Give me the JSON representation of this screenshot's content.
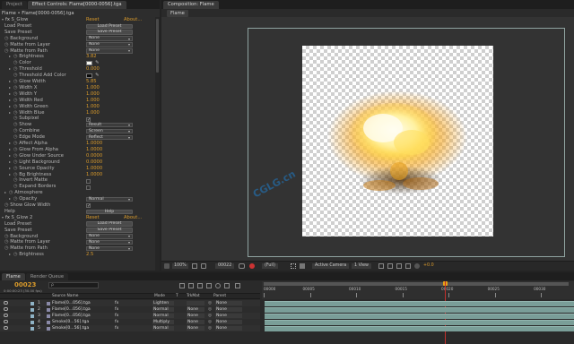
{
  "effect_controls": {
    "tab_project": "Project",
    "tab_title": "Effect Controls: Flame[0000-0056].tga",
    "breadcrumb": "Flame • Flame[0000-0056].tga",
    "effect1": {
      "name": "S_Glow",
      "reset": "Reset",
      "about": "About...",
      "rows": [
        {
          "label": "Load Preset",
          "kind": "button",
          "value": "Load Preset",
          "indent": 1
        },
        {
          "label": "Save Preset",
          "kind": "button",
          "value": "Save Preset",
          "indent": 1
        },
        {
          "label": "Background",
          "kind": "dropdown",
          "value": "None",
          "indent": 1
        },
        {
          "label": "Matte from Layer",
          "kind": "dropdown",
          "value": "None",
          "indent": 1
        },
        {
          "label": "Matte from Path",
          "kind": "dropdown",
          "value": "None",
          "indent": 1
        },
        {
          "label": "Brightness",
          "kind": "value",
          "value": "3.82",
          "indent": 2,
          "tri": true
        },
        {
          "label": "Color",
          "kind": "color",
          "value": "",
          "indent": 3,
          "color": "#f4f4ee"
        },
        {
          "label": "Threshold",
          "kind": "value",
          "value": "0.000",
          "indent": 2,
          "tri": true
        },
        {
          "label": "Threshold Add Color",
          "kind": "color",
          "value": "",
          "indent": 3,
          "color": "#0a0a0a"
        },
        {
          "label": "Glow Width",
          "kind": "value",
          "value": "5.85",
          "indent": 2,
          "tri": true
        },
        {
          "label": "Width X",
          "kind": "value",
          "value": "1.000",
          "indent": 2,
          "tri": true
        },
        {
          "label": "Width Y",
          "kind": "value",
          "value": "1.000",
          "indent": 2,
          "tri": true
        },
        {
          "label": "Width Red",
          "kind": "value",
          "value": "1.000",
          "indent": 2,
          "tri": true
        },
        {
          "label": "Width Green",
          "kind": "value",
          "value": "1.000",
          "indent": 2,
          "tri": true
        },
        {
          "label": "Width Blue",
          "kind": "value",
          "value": "1.000",
          "indent": 2,
          "tri": true
        },
        {
          "label": "Subpixel",
          "kind": "check",
          "value": "✓",
          "indent": 3
        },
        {
          "label": "Show",
          "kind": "dropdown",
          "value": "Result",
          "indent": 3
        },
        {
          "label": "Combine",
          "kind": "dropdown",
          "value": "Screen",
          "indent": 3
        },
        {
          "label": "Edge Mode",
          "kind": "dropdown",
          "value": "Reflect",
          "indent": 3
        },
        {
          "label": "Affect Alpha",
          "kind": "value",
          "value": "1.0000",
          "indent": 2,
          "tri": true
        },
        {
          "label": "Glow From Alpha",
          "kind": "value",
          "value": "1.0000",
          "indent": 2,
          "tri": true
        },
        {
          "label": "Glow Under Source",
          "kind": "value",
          "value": "0.0000",
          "indent": 2,
          "tri": true
        },
        {
          "label": "Light Background",
          "kind": "value",
          "value": "0.0000",
          "indent": 2,
          "tri": true
        },
        {
          "label": "Source Opacity",
          "kind": "value",
          "value": "1.0000",
          "indent": 2,
          "tri": true
        },
        {
          "label": "Bg Brightness",
          "kind": "value",
          "value": "1.0000",
          "indent": 2,
          "tri": true
        },
        {
          "label": "Invert Matte",
          "kind": "check",
          "value": "",
          "indent": 3
        },
        {
          "label": "Expand Borders",
          "kind": "check",
          "value": "",
          "indent": 3
        },
        {
          "label": "Atmosphere",
          "kind": "none",
          "value": "",
          "indent": 1,
          "tri": true
        },
        {
          "label": "Opacity",
          "kind": "dropdown",
          "value": "Normal",
          "indent": 2,
          "tri": true
        },
        {
          "label": "Show Glow Width",
          "kind": "check",
          "value": "✓",
          "indent": 1
        },
        {
          "label": "Help",
          "kind": "button",
          "value": "Help",
          "indent": 1
        }
      ]
    },
    "effect2": {
      "name": "S_Glow 2",
      "reset": "Reset",
      "about": "About...",
      "rows": [
        {
          "label": "Load Preset",
          "kind": "button",
          "value": "Load Preset",
          "indent": 1
        },
        {
          "label": "Save Preset",
          "kind": "button",
          "value": "Save Preset",
          "indent": 1
        },
        {
          "label": "Background",
          "kind": "dropdown",
          "value": "None",
          "indent": 1
        },
        {
          "label": "Matte from Layer",
          "kind": "dropdown",
          "value": "None",
          "indent": 1
        },
        {
          "label": "Matte from Path",
          "kind": "dropdown",
          "value": "None",
          "indent": 1
        },
        {
          "label": "Brightness",
          "kind": "value",
          "value": "2.5",
          "indent": 2,
          "tri": true
        }
      ]
    }
  },
  "composition": {
    "tab_title": "Composition: Flame",
    "subtab": "Flame",
    "watermark": "CGLG.cn",
    "footer": {
      "zoom": "100%",
      "timecode": "00022",
      "resolution": "(Full)",
      "camera": "Active Camera",
      "views": "1 View",
      "exposure": "+0.0"
    }
  },
  "timeline": {
    "tab_flame": "Flame",
    "tab_render": "Render Queue",
    "current_time": "00023",
    "sub_time": "0:00:00:23 (30.00 fps)",
    "search_placeholder": "ρ",
    "columns": {
      "name": "Source Name",
      "mode": "Mode",
      "t": "T",
      "trkmat": "TrkMat",
      "parent": "Parent"
    },
    "ruler": [
      "00000",
      "00005",
      "00010",
      "00015",
      "00020",
      "00025",
      "00030"
    ],
    "layers": [
      {
        "num": "1",
        "name": "Flame[0...056].tga",
        "mode": "Lighten",
        "trkmat": "",
        "parent": "None"
      },
      {
        "num": "2",
        "name": "Flame[0...056].tga",
        "mode": "Normal",
        "trkmat": "None",
        "parent": "None"
      },
      {
        "num": "3",
        "name": "Flame[0...056].tga",
        "mode": "Normal",
        "trkmat": "None",
        "parent": "None"
      },
      {
        "num": "4",
        "name": "Smoke[0...56].tga",
        "mode": "Multiply",
        "trkmat": "None",
        "parent": "None"
      },
      {
        "num": "5",
        "name": "Smoke[0...56].tga",
        "mode": "Normal",
        "trkmat": "None",
        "parent": "None"
      }
    ]
  }
}
